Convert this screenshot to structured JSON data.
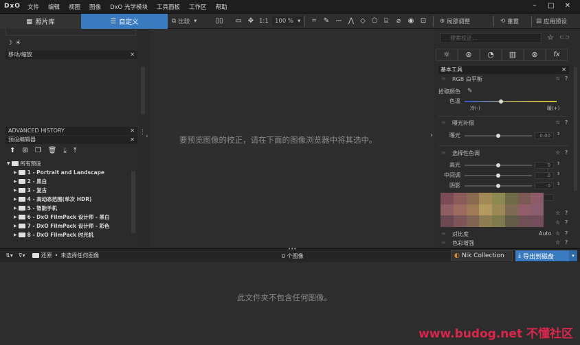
{
  "app": {
    "logo": "DxO",
    "menu": [
      "文件",
      "编辑",
      "视图",
      "图像",
      "DxO 光学模块",
      "工具面板",
      "工作区",
      "帮助"
    ]
  },
  "toolbar": {
    "tab_library": "照片库",
    "tab_custom": "自定义",
    "compare": "比较",
    "zoom_1to1": "1:1",
    "zoom_pct": "100 %",
    "local_adjust": "局部调整",
    "reset": "重置",
    "apply_preset": "应用预设"
  },
  "left": {
    "move_zoom_header": "移动/缩放",
    "history_header": "ADVANCED HISTORY",
    "preset_header": "预设编辑器",
    "tree": [
      {
        "label": "所有预设",
        "level": 0
      },
      {
        "label": "1 - Portrait and Landscape",
        "level": 1
      },
      {
        "label": "2 - 黑白",
        "level": 1
      },
      {
        "label": "3 - 复古",
        "level": 1
      },
      {
        "label": "4 - 高动态范围(单次 HDR)",
        "level": 1
      },
      {
        "label": "5 - 智能手机",
        "level": 1
      },
      {
        "label": "6 - DxO FilmPack 设计师 - 黑白",
        "level": 1
      },
      {
        "label": "7 - DxO FilmPack 设计师 - 彩色",
        "level": 1
      },
      {
        "label": "8 - DxO FilmPack 时光机",
        "level": 1
      }
    ]
  },
  "viewer": {
    "message": "要预览图像的校正，请在下面的图像浏览器中将其选中。"
  },
  "right": {
    "search_placeholder": "搜索校正...",
    "basic_tools": "基本工具",
    "rgb_wb": "RGB 白平衡",
    "pick_color": "拾取颜色",
    "temperature": "色温",
    "cool": "冷(-)",
    "warm": "暖(+)",
    "exposure_comp": "曝光补偿",
    "exposure": "曝光",
    "exposure_val": "0.00",
    "selective_tone": "选择性色调",
    "highlights": "高光",
    "midtones": "中间调",
    "shadows": "阴影",
    "zero": "0",
    "contrast": "对比度",
    "contrast_val": "Auto",
    "color_enhance": "色彩增强"
  },
  "status": {
    "restore": "还原",
    "no_selection": "未选择任何图像",
    "image_count": "0 个图像",
    "nik": "Nik Collection",
    "export": "导出到磁盘"
  },
  "browser": {
    "message": "此文件夹不包含任何图像。"
  },
  "watermark": "www.budog.net 不懂社区"
}
